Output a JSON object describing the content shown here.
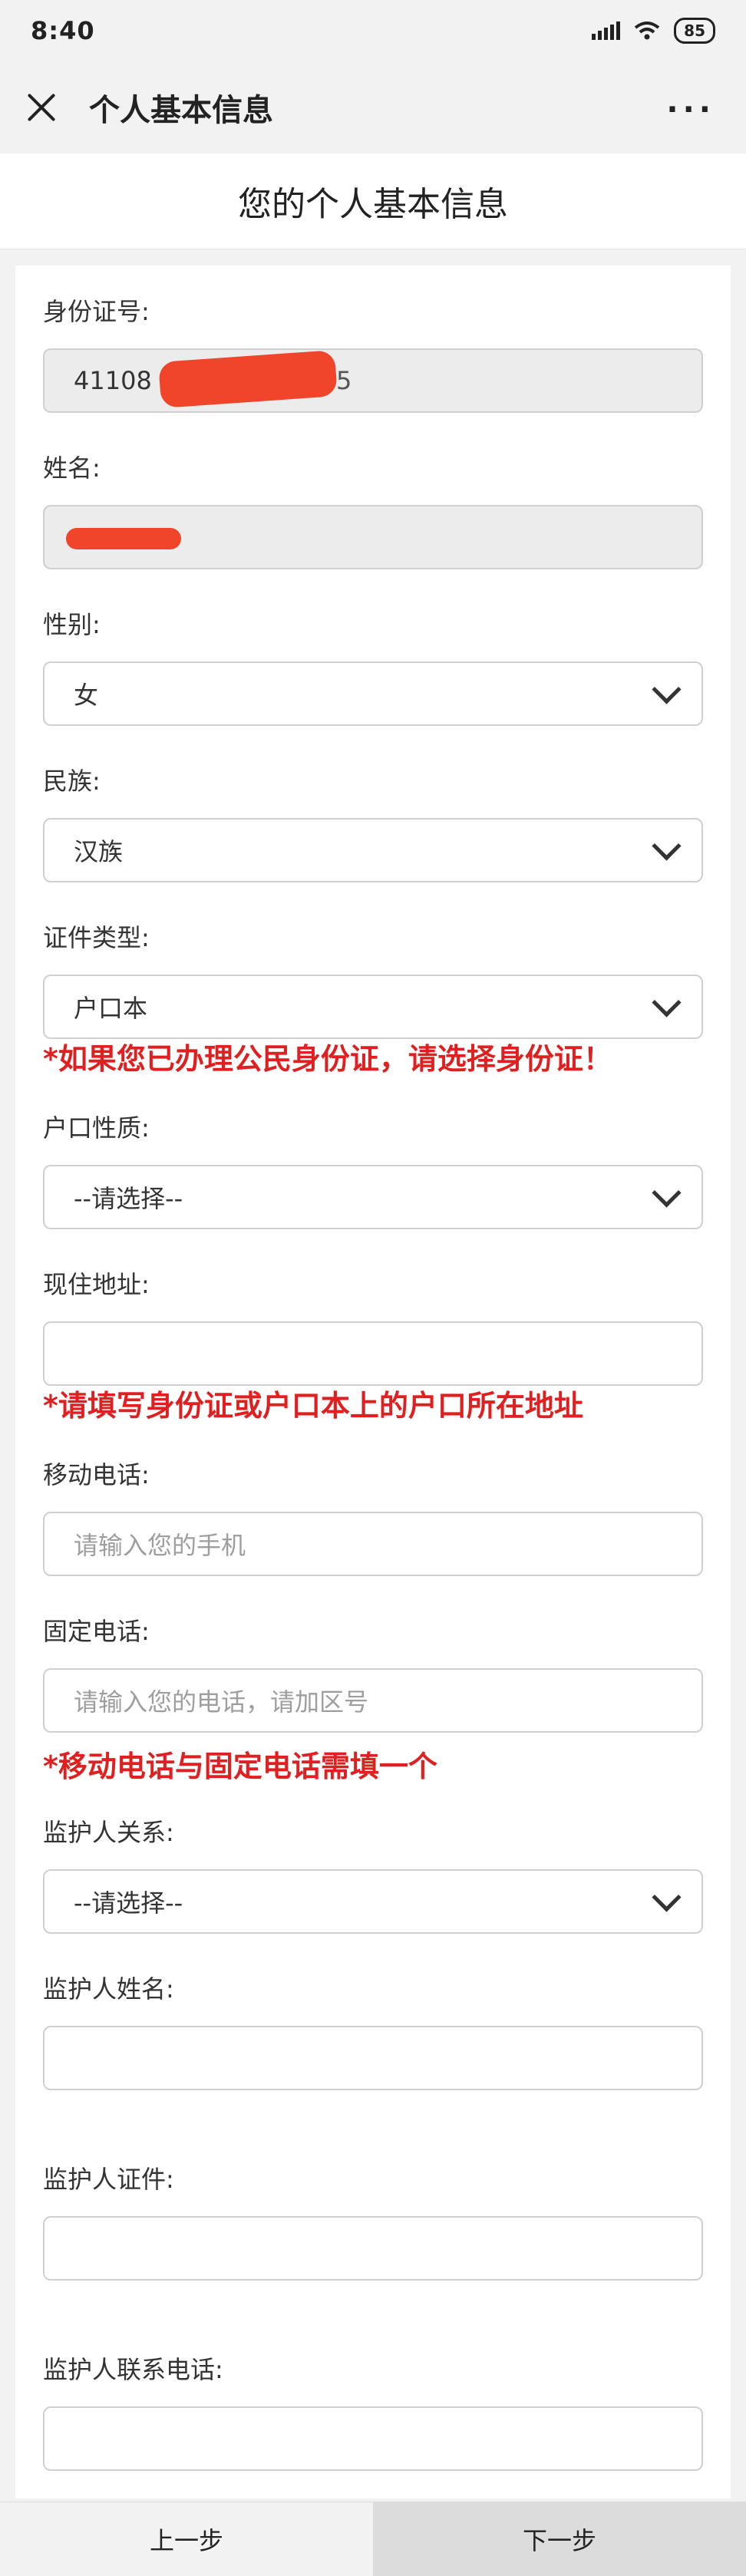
{
  "status": {
    "time": "8:40",
    "battery": "85"
  },
  "nav": {
    "title": "个人基本信息",
    "more": "···"
  },
  "header": {
    "title": "您的个人基本信息"
  },
  "form": {
    "id_label": "身份证号:",
    "id_value": "41108",
    "id_tail": "5",
    "name_label": "姓名:",
    "gender_label": "性别:",
    "gender_value": "女",
    "ethnicity_label": "民族:",
    "ethnicity_value": "汉族",
    "doc_type_label": "证件类型:",
    "doc_type_value": "户口本",
    "doc_type_warning": "*如果您已办理公民身份证，请选择身份证！",
    "hukou_label": "户口性质:",
    "hukou_value": "--请选择--",
    "address_label": "现住地址:",
    "address_value": "",
    "address_warning": "*请填写身份证或户口本上的户口所在地址",
    "mobile_label": "移动电话:",
    "mobile_placeholder": "请输入您的手机",
    "landline_label": "固定电话:",
    "landline_placeholder": "请输入您的电话，请加区号",
    "phone_warning": "*移动电话与固定电话需填一个",
    "guardian_relation_label": "监护人关系:",
    "guardian_relation_value": "--请选择--",
    "guardian_name_label": "监护人姓名:",
    "guardian_id_label": "监护人证件:",
    "guardian_phone_label": "监护人联系电话:"
  },
  "buttons": {
    "prev": "上一步",
    "next": "下一步"
  },
  "colors": {
    "warning": "#e02020",
    "redaction": "#f0442b"
  }
}
